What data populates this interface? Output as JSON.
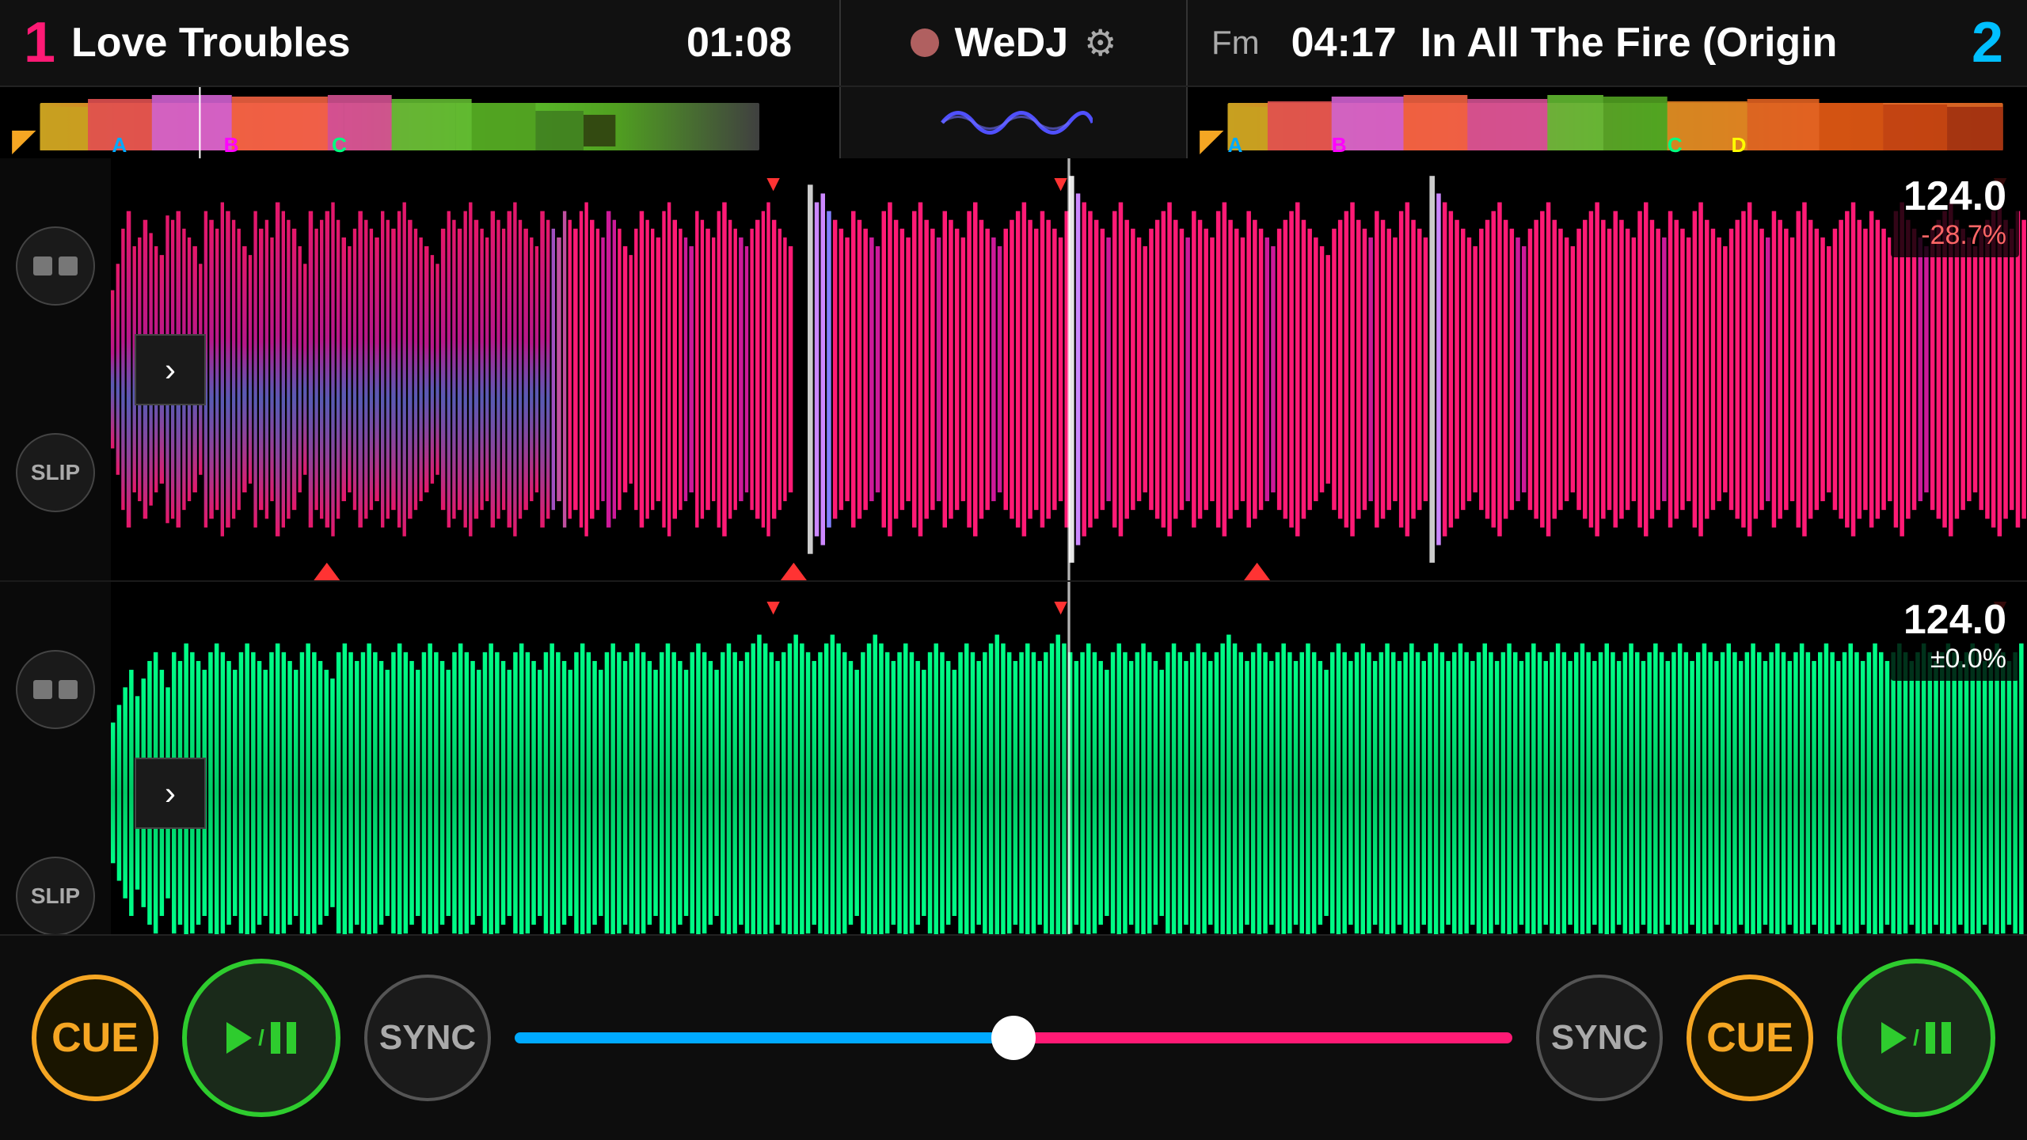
{
  "deck1": {
    "number": "1",
    "title": "Love Troubles",
    "time": "01:08",
    "bpm_top": "124.0",
    "bpm_bottom": "-28.7%",
    "markers": [
      "A",
      "B",
      "C"
    ]
  },
  "deck2": {
    "number": "2",
    "title": "In All The Fire (Origin",
    "time": "04:17",
    "key": "Fm",
    "bpm_top": "124.0",
    "bpm_bottom": "±0.0%",
    "markers": [
      "A",
      "B",
      "C",
      "D"
    ]
  },
  "center": {
    "app_name": "WeDJ"
  },
  "controls": {
    "cue_label": "CUE",
    "play_pause_label": "▶/II",
    "sync_label": "SYNC"
  }
}
